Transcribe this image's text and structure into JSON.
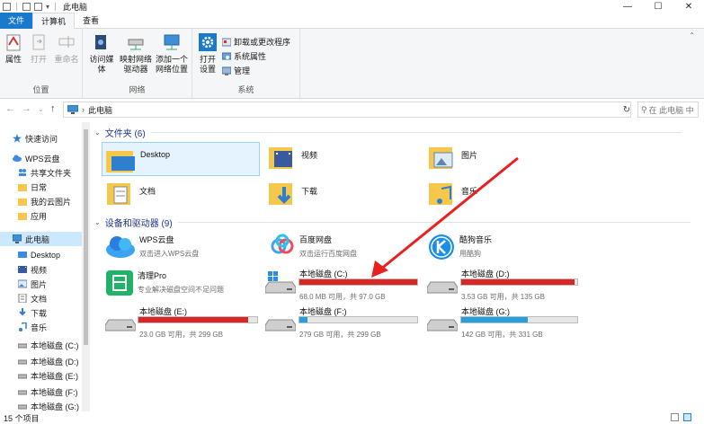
{
  "window": {
    "title": "此电脑",
    "controls": [
      "—",
      "☐",
      "✕"
    ]
  },
  "tabs": [
    {
      "label": "文件"
    },
    {
      "label": "计算机"
    },
    {
      "label": "查看"
    }
  ],
  "ribbon": {
    "location": {
      "label": "位置",
      "buttons": [
        {
          "label": "属性"
        },
        {
          "label": "打开"
        },
        {
          "label": "重命名"
        }
      ]
    },
    "network": {
      "label": "网络",
      "buttons": [
        {
          "label": "访问媒体"
        },
        {
          "label": "映射网络\n驱动器"
        },
        {
          "label": "添加一个\n网络位置"
        }
      ]
    },
    "system": {
      "label": "系统",
      "open_settings": "打开\n设置",
      "small": [
        {
          "label": "卸载或更改程序"
        },
        {
          "label": "系统属性"
        },
        {
          "label": "管理"
        }
      ]
    }
  },
  "address": {
    "path": "此电脑",
    "search_placeholder": "在 此电脑 中"
  },
  "nav": [
    {
      "label": "快速访问"
    },
    {
      "label": "WPS云盘"
    },
    {
      "label": "共享文件夹"
    },
    {
      "label": "日常"
    },
    {
      "label": "我的云图片"
    },
    {
      "label": "应用"
    },
    {
      "label": "此电脑"
    },
    {
      "label": "Desktop"
    },
    {
      "label": "视频"
    },
    {
      "label": "图片"
    },
    {
      "label": "文档"
    },
    {
      "label": "下载"
    },
    {
      "label": "音乐"
    },
    {
      "label": "本地磁盘 (C:)"
    },
    {
      "label": "本地磁盘 (D:)"
    },
    {
      "label": "本地磁盘 (E:)"
    },
    {
      "label": "本地磁盘 (F:)"
    },
    {
      "label": "本地磁盘 (G:)"
    }
  ],
  "folders_header": "文件夹 (6)",
  "folders": [
    {
      "label": "Desktop"
    },
    {
      "label": "视频"
    },
    {
      "label": "图片"
    },
    {
      "label": "文档"
    },
    {
      "label": "下载"
    },
    {
      "label": "音乐"
    }
  ],
  "devices_header": "设备和驱动器 (9)",
  "devices": [
    {
      "label": "WPS云盘",
      "sub": "双击进入WPS云盘"
    },
    {
      "label": "百度网盘",
      "sub": "双击运行百度网盘"
    },
    {
      "label": "酷狗音乐",
      "sub": "用酷狗"
    },
    {
      "label": "清理Pro",
      "sub": "专业解决磁盘空间不足问题"
    }
  ],
  "drives": [
    {
      "label": "本地磁盘 (C:)",
      "info": "68.0 MB 可用，共 97.0 GB",
      "used_fraction": 0.999,
      "color": "#da2626"
    },
    {
      "label": "本地磁盘 (D:)",
      "info": "3.53 GB 可用，共 135 GB",
      "used_fraction": 0.974,
      "color": "#da2626"
    },
    {
      "label": "本地磁盘 (E:)",
      "info": "23.0 GB 可用，共 299 GB",
      "used_fraction": 0.923,
      "color": "#da2626"
    },
    {
      "label": "本地磁盘 (F:)",
      "info": "279 GB 可用，共 299 GB",
      "used_fraction": 0.067,
      "color": "#26a0da"
    },
    {
      "label": "本地磁盘 (G:)",
      "info": "142 GB 可用，共 331 GB",
      "used_fraction": 0.571,
      "color": "#26a0da"
    }
  ],
  "status": "15 个项目",
  "colors": {
    "accent": "#1979ca",
    "warn_bar": "#da2626",
    "ok_bar": "#26a0da",
    "annotation": "#e8201f"
  }
}
